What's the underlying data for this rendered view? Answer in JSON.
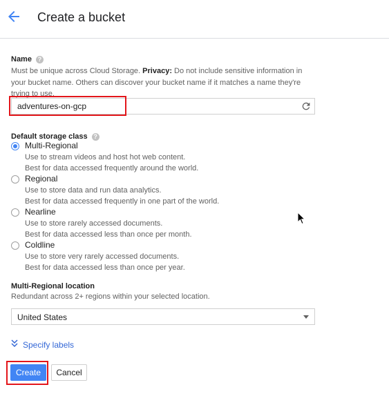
{
  "header": {
    "title": "Create a bucket"
  },
  "name_field": {
    "label": "Name",
    "help": "?",
    "description_part1": "Must be unique across Cloud Storage.",
    "description_privacy_label": "Privacy:",
    "description_part2": "Do not include sensitive information in your bucket name. Others can discover your bucket name if it matches a name they're trying to use.",
    "value": "adventures-on-gcp"
  },
  "storage_class": {
    "label": "Default storage class",
    "help": "?",
    "options": [
      {
        "title": "Multi-Regional",
        "desc1": "Use to stream videos and host hot web content.",
        "desc2": "Best for data accessed frequently around the world.",
        "checked": true
      },
      {
        "title": "Regional",
        "desc1": "Use to store data and run data analytics.",
        "desc2": "Best for data accessed frequently in one part of the world.",
        "checked": false
      },
      {
        "title": "Nearline",
        "desc1": "Use to store rarely accessed documents.",
        "desc2": "Best for data accessed less than once per month.",
        "checked": false
      },
      {
        "title": "Coldline",
        "desc1": "Use to store very rarely accessed documents.",
        "desc2": "Best for data accessed less than once per year.",
        "checked": false
      }
    ]
  },
  "location": {
    "label": "Multi-Regional location",
    "description": "Redundant across 2+ regions within your selected location.",
    "selected": "United States"
  },
  "labels_link": "Specify labels",
  "actions": {
    "create": "Create",
    "cancel": "Cancel"
  },
  "colors": {
    "accent": "#4285f4",
    "link": "#3367d6",
    "highlight": "#e3151a"
  }
}
